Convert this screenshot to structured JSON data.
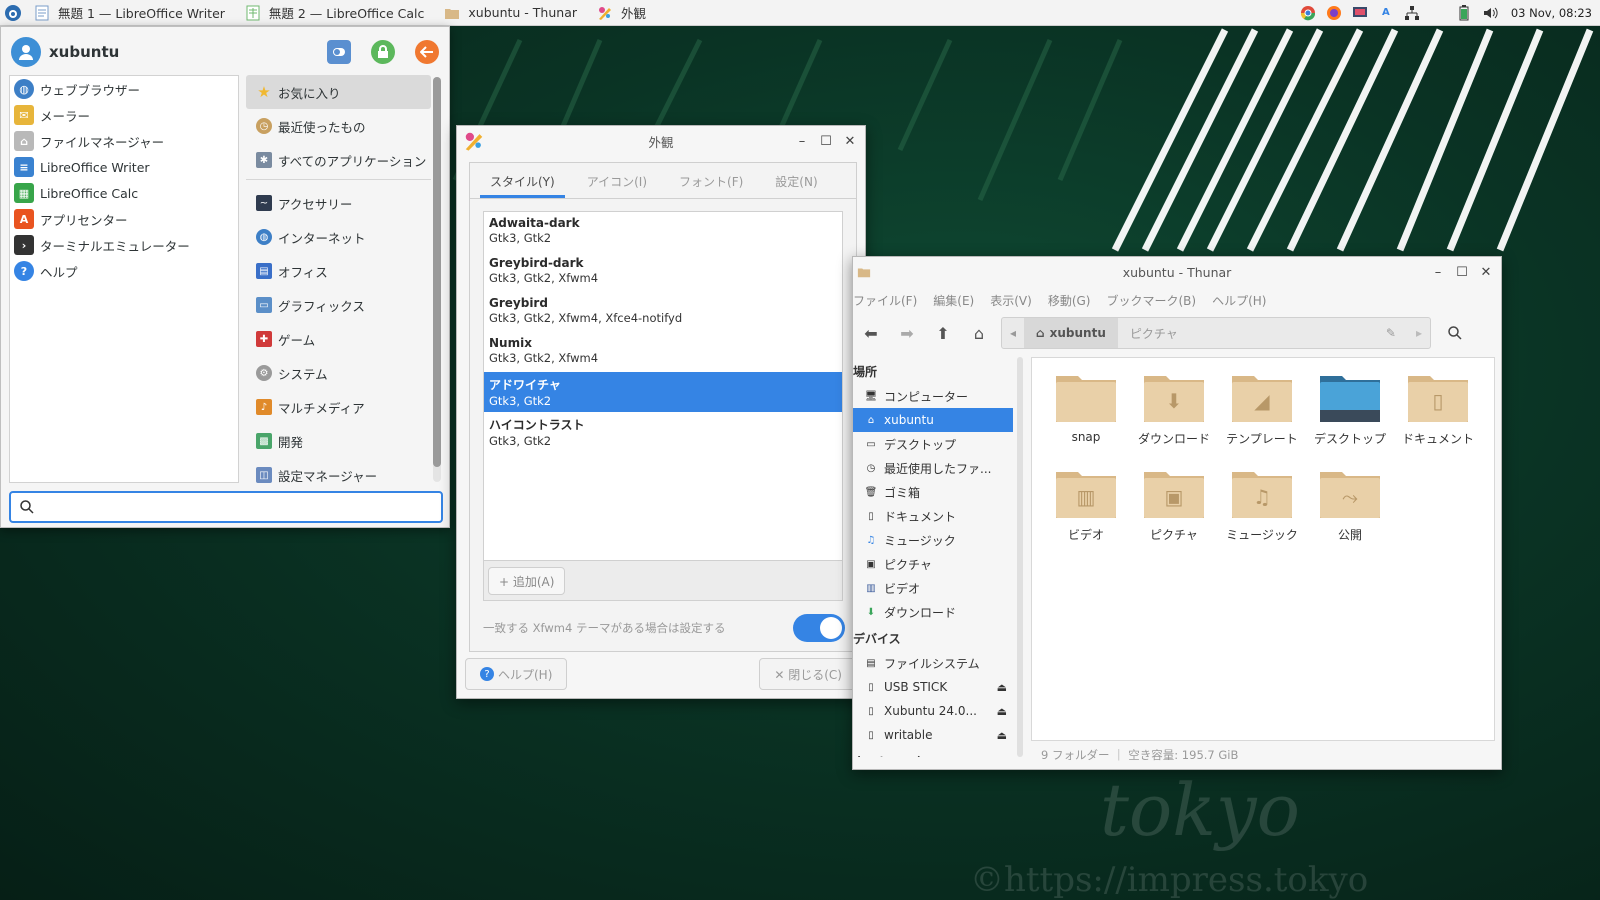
{
  "taskbar": {
    "tasks": [
      {
        "label": "無題 1 — LibreOffice Writer"
      },
      {
        "label": "無題 2 — LibreOffice Calc"
      },
      {
        "label": "xubuntu - Thunar"
      },
      {
        "label": "外観"
      }
    ],
    "clock": "03 Nov, 08:23",
    "tray_font_label": "A"
  },
  "whisker": {
    "username": "xubuntu",
    "favorites": [
      {
        "label": "ウェブブラウザー",
        "icon": "globe-icon",
        "color": "#3d7fc6"
      },
      {
        "label": "メーラー",
        "icon": "mail-icon",
        "color": "#e7b53b"
      },
      {
        "label": "ファイルマネージャー",
        "icon": "home-folder-icon",
        "color": "#b9b9b9"
      },
      {
        "label": "LibreOffice Writer",
        "icon": "writer-icon",
        "color": "#3a82d0"
      },
      {
        "label": "LibreOffice Calc",
        "icon": "calc-icon",
        "color": "#38a54a"
      },
      {
        "label": "アプリセンター",
        "icon": "appcenter-icon",
        "color": "#e95420"
      },
      {
        "label": "ターミナルエミュレーター",
        "icon": "terminal-icon",
        "color": "#333333"
      },
      {
        "label": "ヘルプ",
        "icon": "help-icon",
        "color": "#3584e4"
      }
    ],
    "categories_top": [
      {
        "label": "お気に入り",
        "icon": "star-icon",
        "color": "#f0c040"
      },
      {
        "label": "最近使ったもの",
        "icon": "clock-icon",
        "color": "#c8a060"
      },
      {
        "label": "すべてのアプリケーション",
        "icon": "apps-icon",
        "color": "#7a8ba0"
      }
    ],
    "categories": [
      {
        "label": "アクセサリー",
        "icon": "accessories-icon",
        "color": "#2f3b4f"
      },
      {
        "label": "インターネット",
        "icon": "internet-icon",
        "color": "#3d7fc6"
      },
      {
        "label": "オフィス",
        "icon": "office-icon",
        "color": "#3a6fc8"
      },
      {
        "label": "グラフィックス",
        "icon": "graphics-icon",
        "color": "#5b8fc8"
      },
      {
        "label": "ゲーム",
        "icon": "games-icon",
        "color": "#d03a3a"
      },
      {
        "label": "システム",
        "icon": "system-icon",
        "color": "#9a9a9a"
      },
      {
        "label": "マルチメディア",
        "icon": "multimedia-icon",
        "color": "#e08a2a"
      },
      {
        "label": "開発",
        "icon": "development-icon",
        "color": "#4aa56a"
      },
      {
        "label": "設定マネージャー",
        "icon": "settings-icon",
        "color": "#6b8bbf"
      }
    ]
  },
  "appearance": {
    "title": "外観",
    "tabs": [
      "スタイル(Y)",
      "アイコン(I)",
      "フォント(F)",
      "設定(N)"
    ],
    "themes": [
      {
        "name": "Adwaita-dark",
        "desc": "Gtk3, Gtk2"
      },
      {
        "name": "Greybird-dark",
        "desc": "Gtk3, Gtk2, Xfwm4"
      },
      {
        "name": "Greybird",
        "desc": "Gtk3, Gtk2, Xfwm4, Xfce4-notifyd"
      },
      {
        "name": "Numix",
        "desc": "Gtk3, Gtk2, Xfwm4"
      },
      {
        "name": "アドワイチャ",
        "desc": "Gtk3, Gtk2"
      },
      {
        "name": "ハイコントラスト",
        "desc": "Gtk3, Gtk2"
      }
    ],
    "add_label": "+ 追加(A)",
    "xfwm_label": "一致する Xfwm4 テーマがある場合は設定する",
    "help_label": "ヘルプ(H)",
    "close_label": "✕ 閉じる(C)",
    "accent": "#3584e4"
  },
  "thunar": {
    "title": "xubuntu - Thunar",
    "menu": [
      "ファイル(F)",
      "編集(E)",
      "表示(V)",
      "移動(G)",
      "ブックマーク(B)",
      "ヘルプ(H)"
    ],
    "path": [
      "xubuntu",
      "ピクチャ"
    ],
    "places_header": "場所",
    "places": [
      {
        "label": "コンピューター",
        "icon": "computer-icon"
      },
      {
        "label": "xubuntu",
        "icon": "home-icon"
      },
      {
        "label": "デスクトップ",
        "icon": "desktop-icon"
      },
      {
        "label": "最近使用したファ...",
        "icon": "recent-icon"
      },
      {
        "label": "ゴミ箱",
        "icon": "trash-icon"
      },
      {
        "label": "ドキュメント",
        "icon": "document-icon"
      },
      {
        "label": "ミュージック",
        "icon": "music-icon"
      },
      {
        "label": "ピクチャ",
        "icon": "pictures-icon"
      },
      {
        "label": "ビデオ",
        "icon": "video-icon"
      },
      {
        "label": "ダウンロード",
        "icon": "download-icon"
      }
    ],
    "devices_header": "デバイス",
    "devices": [
      {
        "label": "ファイルシステム",
        "icon": "drive-icon"
      },
      {
        "label": "USB STICK",
        "icon": "usb-icon"
      },
      {
        "label": "Xubuntu 24.0...",
        "icon": "usb-icon"
      },
      {
        "label": "writable",
        "icon": "usb-icon"
      }
    ],
    "network_header": "ネットワーク",
    "files": [
      {
        "label": "snap",
        "icon": "folder-icon"
      },
      {
        "label": "ダウンロード",
        "icon": "folder-download-icon"
      },
      {
        "label": "テンプレート",
        "icon": "folder-templates-icon"
      },
      {
        "label": "デスクトップ",
        "icon": "folder-desktop-icon"
      },
      {
        "label": "ドキュメント",
        "icon": "folder-documents-icon"
      },
      {
        "label": "ビデオ",
        "icon": "folder-video-icon"
      },
      {
        "label": "ピクチャ",
        "icon": "folder-pictures-icon"
      },
      {
        "label": "ミュージック",
        "icon": "folder-music-icon"
      },
      {
        "label": "公開",
        "icon": "folder-public-icon"
      }
    ],
    "status": "9 フォルダー ｜ 空き容量: 195.7 GiB"
  },
  "watermark": {
    "line1": "tokyo",
    "line2": "©https://impress.tokyo"
  }
}
